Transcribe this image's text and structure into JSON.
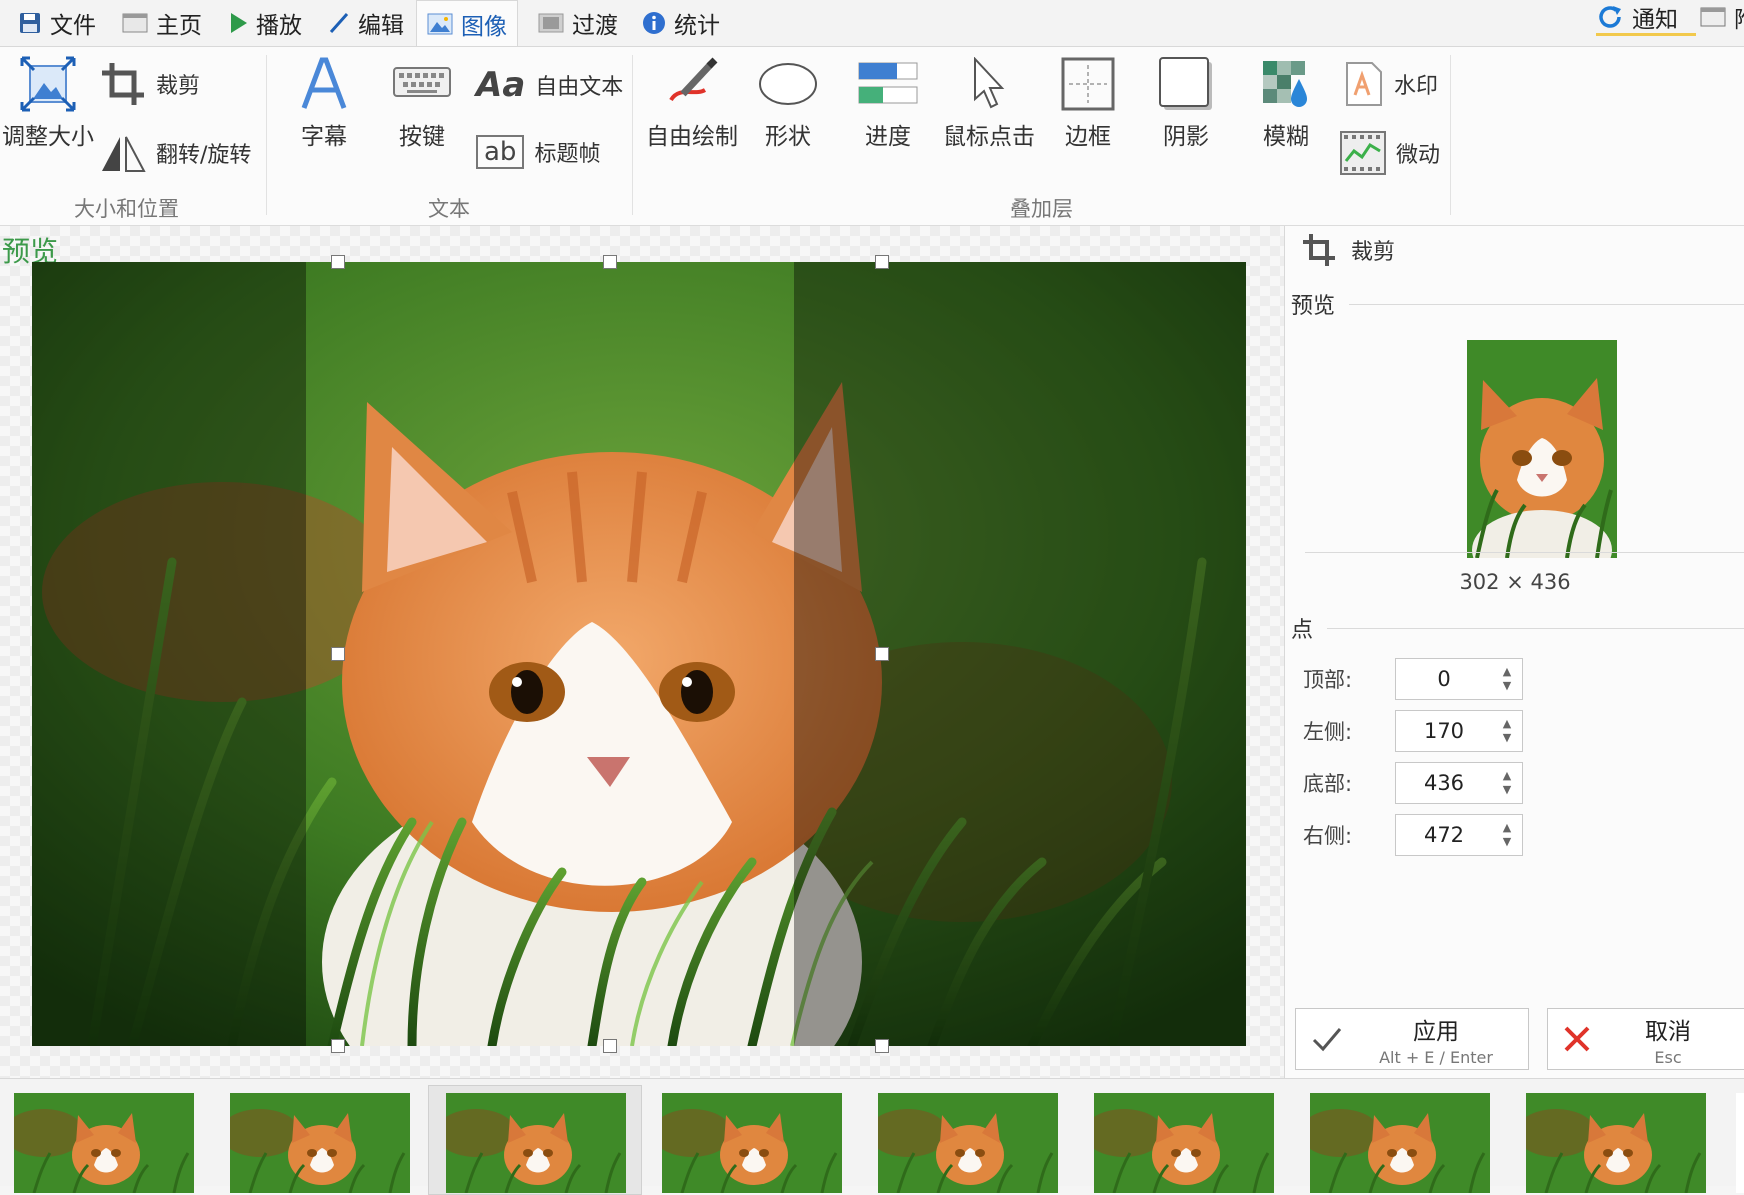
{
  "menu": {
    "tabs": [
      {
        "label": "文件",
        "icon": "save-icon"
      },
      {
        "label": "主页",
        "icon": "home-icon"
      },
      {
        "label": "播放",
        "icon": "play-icon"
      },
      {
        "label": "编辑",
        "icon": "pencil-icon"
      },
      {
        "label": "图像",
        "icon": "image-icon",
        "active": true
      },
      {
        "label": "过渡",
        "icon": "transition-icon"
      },
      {
        "label": "统计",
        "icon": "info-icon"
      }
    ],
    "right_items": [
      {
        "label": "通知",
        "icon": "refresh-icon"
      },
      {
        "label": "附",
        "icon": "window-icon"
      }
    ]
  },
  "ribbon": {
    "groups": {
      "size_position": {
        "label": "大小和位置",
        "resize": "调整大小",
        "crop": "裁剪",
        "flip_rotate": "翻转/旋转"
      },
      "text": {
        "label": "文本",
        "caption": "字幕",
        "keys": "按键",
        "free_text": "自由文本",
        "title_frame": "标题帧"
      },
      "overlay": {
        "label": "叠加层",
        "free_draw": "自由绘制",
        "shape": "形状",
        "progress": "进度",
        "mouse_click": "鼠标点击",
        "border": "边框",
        "shadow": "阴影",
        "blur": "模糊",
        "watermark": "水印",
        "cinemagraph": "微动"
      }
    }
  },
  "preview": {
    "label": "预览"
  },
  "side_panel": {
    "title": "裁剪",
    "preview_label": "预览",
    "size_text": "302 × 436",
    "points_label": "点",
    "fields": [
      {
        "label": "顶部:",
        "value": "0"
      },
      {
        "label": "左侧:",
        "value": "170"
      },
      {
        "label": "底部:",
        "value": "436"
      },
      {
        "label": "右侧:",
        "value": "472"
      }
    ],
    "apply": {
      "label": "应用",
      "shortcut": "Alt + E / Enter"
    },
    "cancel": {
      "label": "取消",
      "shortcut": "Esc"
    }
  },
  "colors": {
    "accent_blue": "#1c5fb5",
    "preview_green": "#3c9a4a",
    "cancel_red": "#e0332a",
    "apply_check": "#555555"
  }
}
